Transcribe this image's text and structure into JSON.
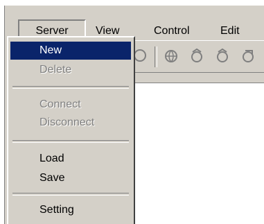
{
  "menubar": {
    "items": [
      {
        "label": "Server"
      },
      {
        "label": "View"
      },
      {
        "label": "Control"
      },
      {
        "label": "Edit"
      }
    ]
  },
  "toolbar": {
    "icons": [
      "separator-icon",
      "globe-icon",
      "globe-arrow-icon",
      "globe-arrow-icon",
      "globe-arrow-icon"
    ]
  },
  "server_menu": {
    "items": [
      {
        "label": "New",
        "state": "highlighted"
      },
      {
        "label": "Delete",
        "state": "disabled"
      },
      {
        "label": "Connect",
        "state": "disabled"
      },
      {
        "label": "Disconnect",
        "state": "disabled"
      },
      {
        "label": "Load",
        "state": "enabled"
      },
      {
        "label": "Save",
        "state": "enabled"
      },
      {
        "label": "Setting",
        "state": "enabled"
      }
    ]
  },
  "colors": {
    "face": "#d4d0c8",
    "highlight": "#0a246a",
    "disabled_text": "#808080"
  }
}
